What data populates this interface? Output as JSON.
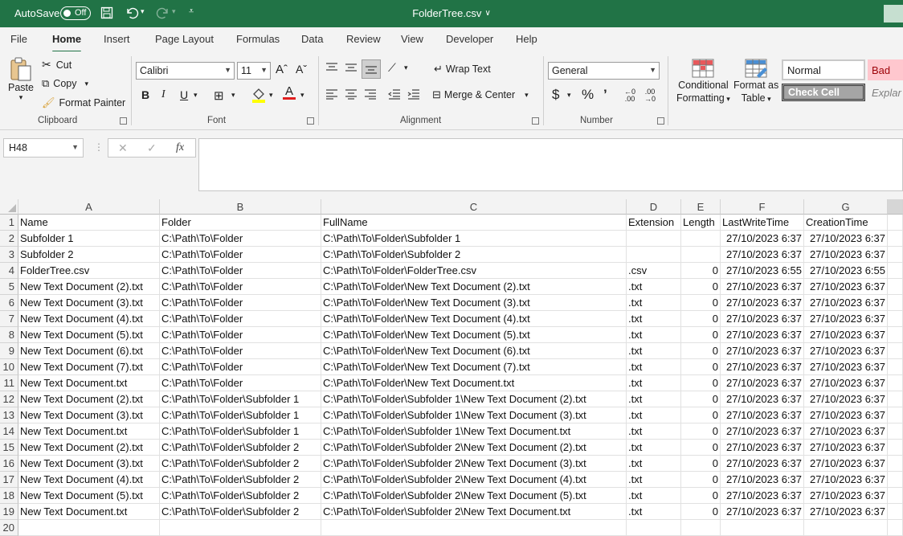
{
  "titlebar": {
    "autosave_label": "AutoSave",
    "autosave_state": "Off",
    "file_title": "FolderTree.csv",
    "title_chevron": "∨",
    "save_icon": "save-icon",
    "undo_icon": "undo-icon",
    "redo_icon": "redo-icon",
    "brand_color": "#217346"
  },
  "menu": {
    "tabs": [
      "File",
      "Home",
      "Insert",
      "Page Layout",
      "Formulas",
      "Data",
      "Review",
      "View",
      "Developer",
      "Help"
    ],
    "active": "Home"
  },
  "ribbon": {
    "clipboard": {
      "paste": "Paste",
      "cut": "Cut",
      "copy": "Copy",
      "format_painter": "Format Painter",
      "label": "Clipboard"
    },
    "font": {
      "font_name": "Calibri",
      "font_size": "11",
      "bold": "B",
      "italic": "I",
      "underline": "U",
      "label": "Font",
      "grow": "Aˆ",
      "shrink": "Aˇ"
    },
    "alignment": {
      "wrap_text": "Wrap Text",
      "merge_center": "Merge & Center",
      "label": "Alignment"
    },
    "number": {
      "format": "General",
      "label": "Number",
      "currency": "$",
      "percent": "%",
      "comma": "’"
    },
    "styles": {
      "conditional": "Conditional",
      "formatting": "Formatting",
      "format_as": "Format as",
      "table": "Table",
      "normal": "Normal",
      "bad": "Bad",
      "check_cell": "Check Cell",
      "explanatory": "Explar"
    }
  },
  "formula_bar": {
    "name_box": "H48",
    "cancel": "✕",
    "enter": "✓",
    "fx": "fx",
    "value": ""
  },
  "sheet": {
    "columns": [
      "A",
      "B",
      "C",
      "D",
      "E",
      "F",
      "G"
    ],
    "row_numbers": [
      "1",
      "2",
      "3",
      "4",
      "5",
      "6",
      "7",
      "8",
      "9",
      "10",
      "11",
      "12",
      "13",
      "14",
      "15",
      "16",
      "17",
      "18",
      "19",
      "20"
    ],
    "rows": [
      [
        "Name",
        "Folder",
        "FullName",
        "Extension",
        "Length",
        "LastWriteTime",
        "CreationTime"
      ],
      [
        "Subfolder 1",
        "C:\\Path\\To\\Folder",
        "C:\\Path\\To\\Folder\\Subfolder 1",
        "",
        "",
        "27/10/2023 6:37",
        "27/10/2023 6:37"
      ],
      [
        "Subfolder 2",
        "C:\\Path\\To\\Folder",
        "C:\\Path\\To\\Folder\\Subfolder 2",
        "",
        "",
        "27/10/2023 6:37",
        "27/10/2023 6:37"
      ],
      [
        "FolderTree.csv",
        "C:\\Path\\To\\Folder",
        "C:\\Path\\To\\Folder\\FolderTree.csv",
        ".csv",
        "0",
        "27/10/2023 6:55",
        "27/10/2023 6:55"
      ],
      [
        "New Text Document (2).txt",
        "C:\\Path\\To\\Folder",
        "C:\\Path\\To\\Folder\\New Text Document (2).txt",
        ".txt",
        "0",
        "27/10/2023 6:37",
        "27/10/2023 6:37"
      ],
      [
        "New Text Document (3).txt",
        "C:\\Path\\To\\Folder",
        "C:\\Path\\To\\Folder\\New Text Document (3).txt",
        ".txt",
        "0",
        "27/10/2023 6:37",
        "27/10/2023 6:37"
      ],
      [
        "New Text Document (4).txt",
        "C:\\Path\\To\\Folder",
        "C:\\Path\\To\\Folder\\New Text Document (4).txt",
        ".txt",
        "0",
        "27/10/2023 6:37",
        "27/10/2023 6:37"
      ],
      [
        "New Text Document (5).txt",
        "C:\\Path\\To\\Folder",
        "C:\\Path\\To\\Folder\\New Text Document (5).txt",
        ".txt",
        "0",
        "27/10/2023 6:37",
        "27/10/2023 6:37"
      ],
      [
        "New Text Document (6).txt",
        "C:\\Path\\To\\Folder",
        "C:\\Path\\To\\Folder\\New Text Document (6).txt",
        ".txt",
        "0",
        "27/10/2023 6:37",
        "27/10/2023 6:37"
      ],
      [
        "New Text Document (7).txt",
        "C:\\Path\\To\\Folder",
        "C:\\Path\\To\\Folder\\New Text Document (7).txt",
        ".txt",
        "0",
        "27/10/2023 6:37",
        "27/10/2023 6:37"
      ],
      [
        "New Text Document.txt",
        "C:\\Path\\To\\Folder",
        "C:\\Path\\To\\Folder\\New Text Document.txt",
        ".txt",
        "0",
        "27/10/2023 6:37",
        "27/10/2023 6:37"
      ],
      [
        "New Text Document (2).txt",
        "C:\\Path\\To\\Folder\\Subfolder 1",
        "C:\\Path\\To\\Folder\\Subfolder 1\\New Text Document (2).txt",
        ".txt",
        "0",
        "27/10/2023 6:37",
        "27/10/2023 6:37"
      ],
      [
        "New Text Document (3).txt",
        "C:\\Path\\To\\Folder\\Subfolder 1",
        "C:\\Path\\To\\Folder\\Subfolder 1\\New Text Document (3).txt",
        ".txt",
        "0",
        "27/10/2023 6:37",
        "27/10/2023 6:37"
      ],
      [
        "New Text Document.txt",
        "C:\\Path\\To\\Folder\\Subfolder 1",
        "C:\\Path\\To\\Folder\\Subfolder 1\\New Text Document.txt",
        ".txt",
        "0",
        "27/10/2023 6:37",
        "27/10/2023 6:37"
      ],
      [
        "New Text Document (2).txt",
        "C:\\Path\\To\\Folder\\Subfolder 2",
        "C:\\Path\\To\\Folder\\Subfolder 2\\New Text Document (2).txt",
        ".txt",
        "0",
        "27/10/2023 6:37",
        "27/10/2023 6:37"
      ],
      [
        "New Text Document (3).txt",
        "C:\\Path\\To\\Folder\\Subfolder 2",
        "C:\\Path\\To\\Folder\\Subfolder 2\\New Text Document (3).txt",
        ".txt",
        "0",
        "27/10/2023 6:37",
        "27/10/2023 6:37"
      ],
      [
        "New Text Document (4).txt",
        "C:\\Path\\To\\Folder\\Subfolder 2",
        "C:\\Path\\To\\Folder\\Subfolder 2\\New Text Document (4).txt",
        ".txt",
        "0",
        "27/10/2023 6:37",
        "27/10/2023 6:37"
      ],
      [
        "New Text Document (5).txt",
        "C:\\Path\\To\\Folder\\Subfolder 2",
        "C:\\Path\\To\\Folder\\Subfolder 2\\New Text Document (5).txt",
        ".txt",
        "0",
        "27/10/2023 6:37",
        "27/10/2023 6:37"
      ],
      [
        "New Text Document.txt",
        "C:\\Path\\To\\Folder\\Subfolder 2",
        "C:\\Path\\To\\Folder\\Subfolder 2\\New Text Document.txt",
        ".txt",
        "0",
        "27/10/2023 6:37",
        "27/10/2023 6:37"
      ],
      [
        "",
        "",
        "",
        "",
        "",
        "",
        ""
      ]
    ]
  }
}
